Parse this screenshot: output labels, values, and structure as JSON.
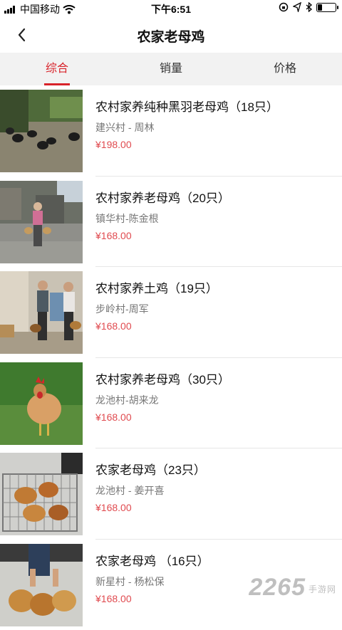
{
  "status": {
    "carrier": "中国移动",
    "time": "下午6:51",
    "battery_level": 0.25
  },
  "nav": {
    "title": "农家老母鸡",
    "back_icon": "chevron-left-icon"
  },
  "tabs": [
    {
      "label": "综合",
      "active": true
    },
    {
      "label": "销量",
      "active": false
    },
    {
      "label": "价格",
      "active": false
    }
  ],
  "products": [
    {
      "name": "农村家养纯种黑羽老母鸡（18只）",
      "seller": "建兴村 - 周林",
      "price": "¥198.00"
    },
    {
      "name": "农村家养老母鸡（20只）",
      "seller": "镇华村-陈金根",
      "price": "¥168.00"
    },
    {
      "name": "农村家养土鸡（19只）",
      "seller": "步岭村-周军",
      "price": "¥168.00"
    },
    {
      "name": "农村家养老母鸡（30只）",
      "seller": "龙池村-胡来龙",
      "price": "¥168.00"
    },
    {
      "name": "农家老母鸡（23只）",
      "seller": "龙池村 - 姜开喜",
      "price": "¥168.00"
    },
    {
      "name": "农家老母鸡 （16只）",
      "seller": "新星村 - 杨松保",
      "price": "¥168.00"
    }
  ],
  "watermark": {
    "text": "2265",
    "sub": "手游网"
  },
  "colors": {
    "accent": "#d8232a",
    "price": "#e04a4f",
    "tab_bg": "#f2f2f2"
  }
}
